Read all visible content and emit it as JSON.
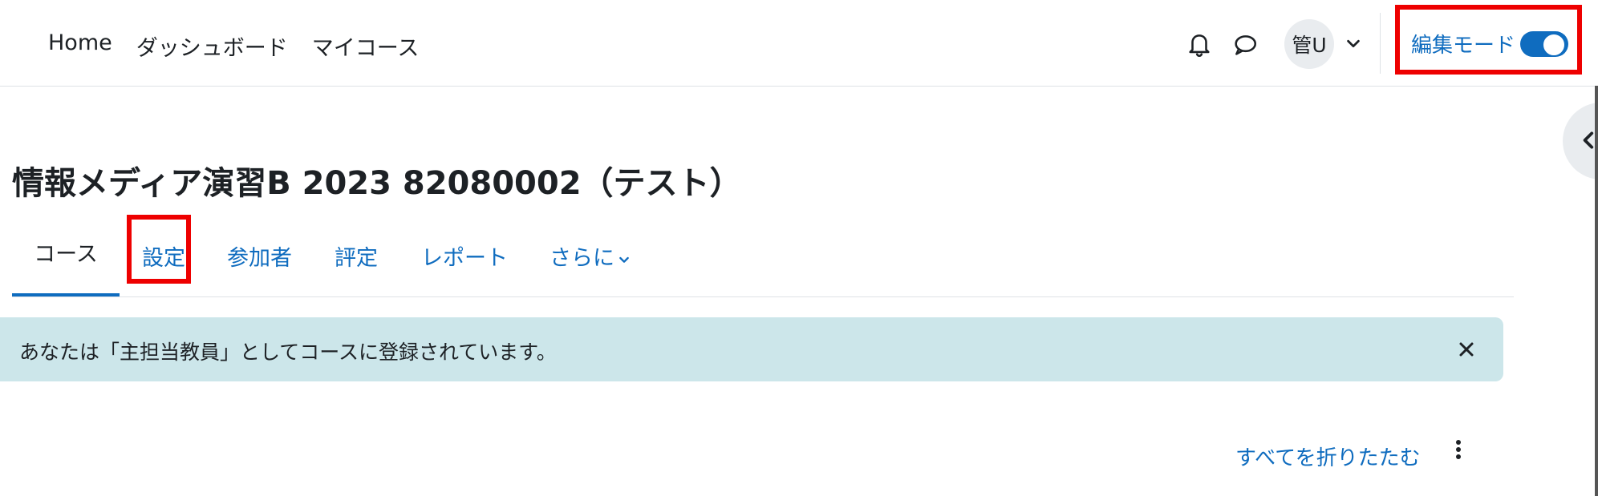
{
  "navbar": {
    "links": [
      "Home",
      "ダッシュボード",
      "マイコース"
    ],
    "user_initials": "管U",
    "edit_mode_label": "編集モード",
    "edit_mode_on": true
  },
  "course": {
    "title": "情報メディア演習B 2023 82080002（テスト）"
  },
  "tabs": {
    "course": "コース",
    "settings": "設定",
    "participants": "参加者",
    "grades": "評定",
    "reports": "レポート",
    "more": "さらに"
  },
  "alert": {
    "text": "あなたは「主担当教員」としてコースに登録されています。"
  },
  "actions": {
    "collapse_all": "すべてを折りたたむ"
  },
  "colors": {
    "accent": "#0f6cbf",
    "alert_bg": "#cce6ea",
    "highlight": "#ee0000"
  },
  "icons": {
    "bell": "bell-icon",
    "chat": "chat-icon",
    "user_menu": "chevron-down-icon",
    "drawer": "chevron-left-icon",
    "close": "close-icon",
    "more_actions": "kebab-icon"
  }
}
